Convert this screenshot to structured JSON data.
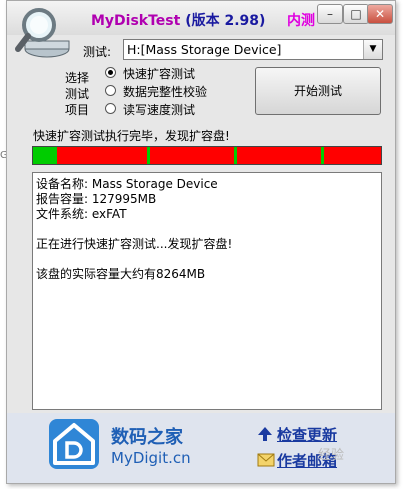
{
  "window": {
    "title_app": "MyDiskTest",
    "title_version": "(版本 2.98)",
    "title_extra": "内测",
    "buttons": {
      "minimize": "–",
      "restore": "□",
      "close": "✕"
    }
  },
  "form": {
    "test_label": "测试:",
    "device_selected": "H:[Mass Storage Device]",
    "options_label_1": "选择",
    "options_label_2": "测试",
    "options_label_3": "项目",
    "options": [
      {
        "label": "快速扩容测试",
        "selected": true
      },
      {
        "label": "数据完整性校验",
        "selected": false
      },
      {
        "label": "读写速度测试",
        "selected": false
      }
    ],
    "start_button": "开始测试"
  },
  "status": {
    "message": "快速扩容测试执行完毕，发现扩容盘!",
    "progress_fraction": 0.07,
    "colors": {
      "ok": "#00cc00",
      "bad": "#ff0000"
    }
  },
  "log": [
    "设备名称: Mass Storage Device",
    "报告容量: 127995MB",
    "文件系统: exFAT",
    "",
    "正在进行快速扩容测试...发现扩容盘!",
    "",
    "该盘的实际容量大约有8264MB"
  ],
  "footer": {
    "brand_cn": "数码之家",
    "brand_en": "MyDigit.cn",
    "check_update": "检查更新",
    "author_email": "作者邮箱",
    "icons": {
      "logo": "house-d-logo-icon",
      "update": "arrow-up-icon",
      "mail": "envelope-icon"
    }
  },
  "overlay": {
    "watermark": "经验"
  }
}
